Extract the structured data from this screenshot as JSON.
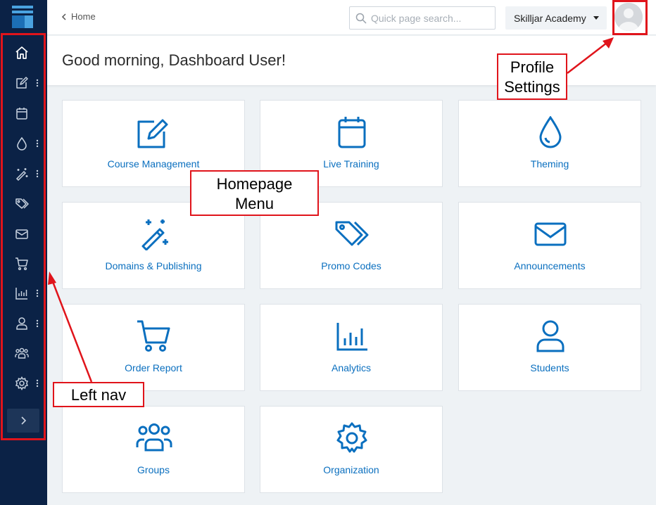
{
  "topbar": {
    "breadcrumb": "Home",
    "search_placeholder": "Quick page search...",
    "org_name": "Skilljar Academy"
  },
  "greeting": "Good morning, Dashboard User!",
  "sidebar": {
    "items": [
      {
        "icon": "home-icon",
        "has_menu": false
      },
      {
        "icon": "edit-icon",
        "has_menu": true
      },
      {
        "icon": "calendar-icon",
        "has_menu": false
      },
      {
        "icon": "droplet-icon",
        "has_menu": true
      },
      {
        "icon": "magic-wand-icon",
        "has_menu": true
      },
      {
        "icon": "tags-icon",
        "has_menu": false
      },
      {
        "icon": "envelope-icon",
        "has_menu": false
      },
      {
        "icon": "cart-icon",
        "has_menu": false
      },
      {
        "icon": "bar-chart-icon",
        "has_menu": true
      },
      {
        "icon": "user-icon",
        "has_menu": true
      },
      {
        "icon": "users-icon",
        "has_menu": false
      },
      {
        "icon": "gear-icon",
        "has_menu": true
      }
    ],
    "expand_icon": "chevron-right-icon"
  },
  "tiles": [
    {
      "label": "Course Management",
      "icon": "edit-icon"
    },
    {
      "label": "Live Training",
      "icon": "calendar-icon"
    },
    {
      "label": "Theming",
      "icon": "droplet-icon"
    },
    {
      "label": "Domains & Publishing",
      "icon": "magic-wand-icon"
    },
    {
      "label": "Promo Codes",
      "icon": "tags-icon"
    },
    {
      "label": "Announcements",
      "icon": "envelope-icon"
    },
    {
      "label": "Order Report",
      "icon": "cart-icon"
    },
    {
      "label": "Analytics",
      "icon": "bar-chart-icon"
    },
    {
      "label": "Students",
      "icon": "user-icon"
    },
    {
      "label": "Groups",
      "icon": "users-icon"
    },
    {
      "label": "Organization",
      "icon": "gear-icon"
    }
  ],
  "annotations": {
    "homepage_menu": [
      "Homepage",
      "Menu"
    ],
    "profile_settings": [
      "Profile",
      "Settings"
    ],
    "left_nav": "Left nav"
  },
  "colors": {
    "sidebar": "#0b2246",
    "accent": "#0a6fbf",
    "annotation": "#e0141b"
  }
}
